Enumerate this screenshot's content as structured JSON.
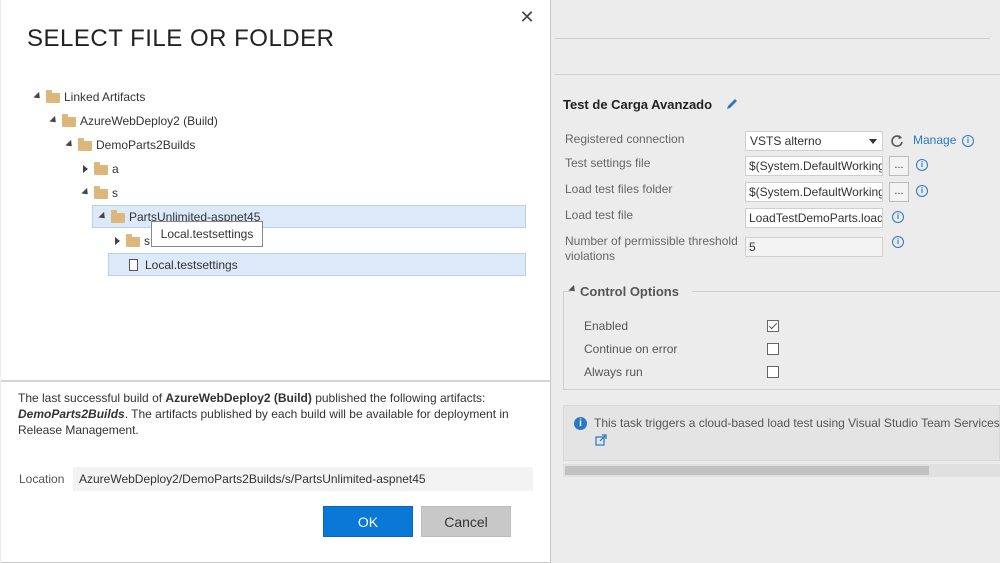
{
  "dialog": {
    "title": "SELECT FILE OR FOLDER",
    "tree": {
      "linked_artifacts": "Linked Artifacts",
      "build": "AzureWebDeploy2 (Build)",
      "demo": "DemoParts2Builds",
      "folder_a": "a",
      "folder_s": "s",
      "parts_unlimited": "PartsUnlimited-aspnet45",
      "folder_sub": "s",
      "file": "Local.testsettings"
    },
    "tooltip": "Local.testsettings",
    "info": {
      "pre": "The last successful build of ",
      "build_name": "AzureWebDeploy2 (Build)",
      "mid": " published the following artifacts: ",
      "artifact_name": "DemoParts2Builds",
      "post": ". The artifacts published by each build will be available for deployment in Release Management."
    },
    "location_label": "Location",
    "location_value": "AzureWebDeploy2/DemoParts2Builds/s/PartsUnlimited-aspnet45",
    "ok_label": "OK",
    "cancel_label": "Cancel"
  },
  "task": {
    "title": "Test de Carga Avanzado",
    "fields": {
      "connection_label": "Registered connection",
      "connection_value": "VSTS alterno",
      "manage_label": "Manage",
      "settings_label": "Test settings file",
      "settings_value": "$(System.DefaultWorkingDirectory)",
      "folder_label": "Load test files folder",
      "folder_value": "$(System.DefaultWorkingDirectory)",
      "loadfile_label": "Load test file",
      "loadfile_value": "LoadTestDemoParts.loadtest",
      "threshold_label": "Number of permissible threshold violations",
      "threshold_value": "5"
    },
    "control_options": {
      "title": "Control Options",
      "enabled": "Enabled",
      "continue": "Continue on error",
      "always": "Always run",
      "enabled_checked": true,
      "continue_checked": false,
      "always_checked": false
    },
    "notice": "This task triggers a cloud-based load test using Visual Studio Team Services."
  },
  "colors": {
    "accent": "#0a78d7",
    "selection": "#dbe9f8",
    "folder": "#dcb67a"
  }
}
